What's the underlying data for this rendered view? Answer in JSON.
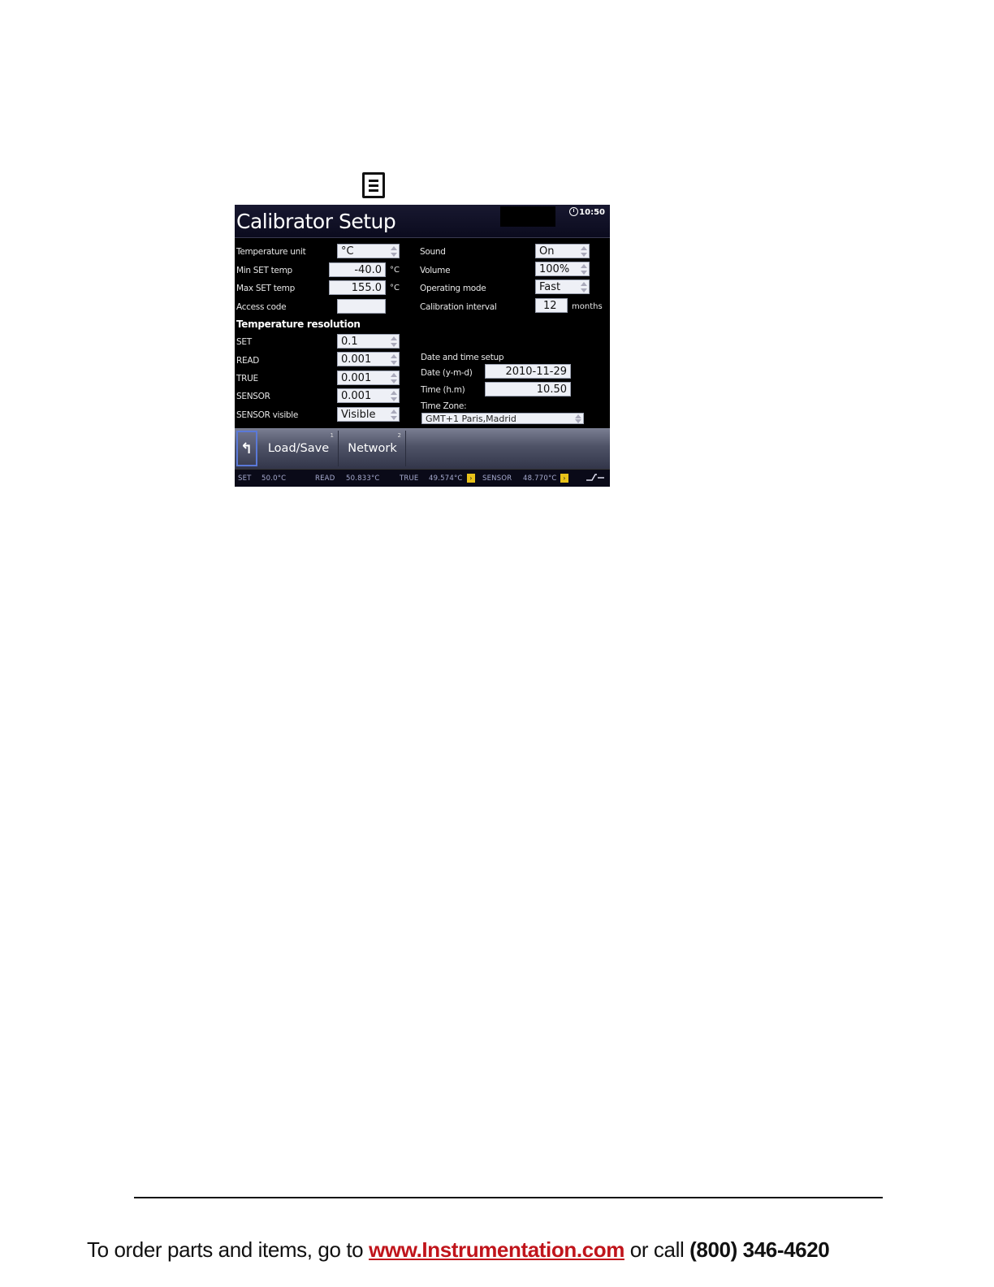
{
  "menu_icon": "menu-list-icon",
  "screen": {
    "title": "Calibrator Setup",
    "clock": "10:50",
    "left": {
      "temp_unit_label": "Temperature unit",
      "temp_unit_value": "°C",
      "min_set_label": "Min SET temp",
      "min_set_value": "-40.0",
      "min_set_unit": "°C",
      "max_set_label": "Max SET temp",
      "max_set_value": "155.0",
      "max_set_unit": "°C",
      "access_code_label": "Access code",
      "access_code_value": "",
      "resolution_heading": "Temperature resolution",
      "set_label": "SET",
      "set_value": "0.1",
      "read_label": "READ",
      "read_value": "0.001",
      "true_label": "TRUE",
      "true_value": "0.001",
      "sensor_label": "SENSOR",
      "sensor_value": "0.001",
      "sensor_visible_label": "SENSOR visible",
      "sensor_visible_value": "Visible"
    },
    "right": {
      "sound_label": "Sound",
      "sound_value": "On",
      "volume_label": "Volume",
      "volume_value": "100%",
      "operating_mode_label": "Operating mode",
      "operating_mode_value": "Fast",
      "cal_interval_label": "Calibration  interval",
      "cal_interval_value": "12",
      "cal_interval_unit": "months",
      "datetime_heading": "Date and time setup",
      "date_label": "Date (y-m-d)",
      "date_value": "2010-11-29",
      "time_label": "Time (h.m)",
      "time_value": "10.50",
      "timezone_label": "Time Zone:",
      "timezone_value": "GMT+1 Paris,Madrid"
    },
    "toolbar": {
      "back_icon": "↰",
      "load_save_label": "Load/Save",
      "load_save_key": "1",
      "network_label": "Network",
      "network_key": "2"
    },
    "status": {
      "set_label": "SET",
      "set_value": "50.0°C",
      "read_label": "READ",
      "read_value": "50.833°C",
      "true_label": "TRUE",
      "true_value": "49.574°C",
      "sensor_label": "SENSOR",
      "sensor_value": "48.770°C",
      "flag_color": "#e8c21a"
    }
  },
  "footer": {
    "prefix": "To order parts and items, go to ",
    "link": "www.Instrumentation.com",
    "middle": " or call  ",
    "phone": "(800) 346-4620"
  }
}
